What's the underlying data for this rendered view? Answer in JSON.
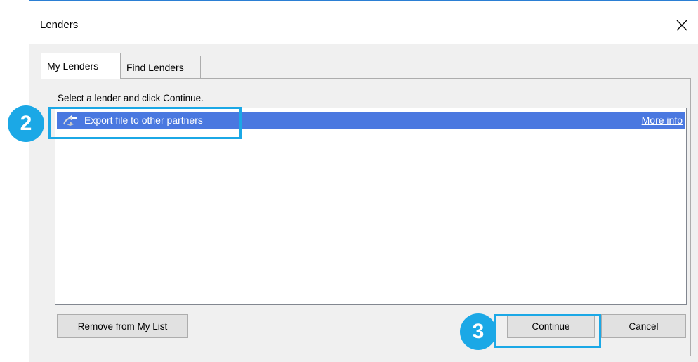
{
  "window": {
    "title": "Lenders"
  },
  "tabs": [
    {
      "label": "My Lenders",
      "active": true
    },
    {
      "label": "Find Lenders",
      "active": false
    }
  ],
  "panel": {
    "instruction": "Select a lender and click Continue.",
    "list": [
      {
        "icon": "exchange-arrows-icon",
        "label": "Export file to other partners",
        "link": "More info",
        "selected": true
      }
    ]
  },
  "buttons": {
    "remove": "Remove from My List",
    "continue": "Continue",
    "cancel": "Cancel"
  },
  "callouts": [
    {
      "number": "2"
    },
    {
      "number": "3"
    }
  ],
  "colors": {
    "selection": "#4a78e0",
    "callout": "#1ba8e6",
    "window_border": "#2b7fd4"
  }
}
